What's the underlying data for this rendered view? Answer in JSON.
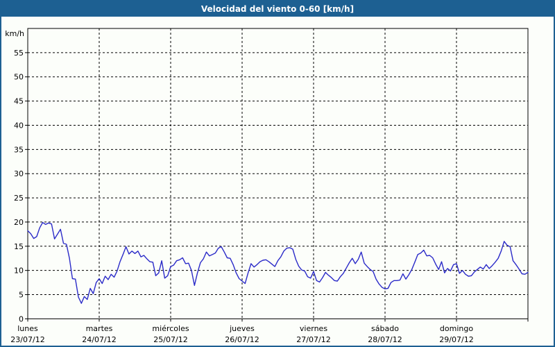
{
  "window": {
    "title": "Velocidad del viento 0-60 [km/h]"
  },
  "colors": {
    "titlebar_bg": "#1d6092",
    "titlebar_text": "#ffffff",
    "frame": "#1d6092",
    "background": "#fcfefa",
    "line": "#2a2ac8",
    "grid": "#000000",
    "axis": "#000000",
    "text": "#000000"
  },
  "chart_data": {
    "type": "line",
    "title": "Velocidad del viento 0-60 [km/h]",
    "ylabel": "km/h",
    "ylim": [
      0,
      60
    ],
    "y_ticks": [
      0,
      5,
      10,
      15,
      20,
      25,
      30,
      35,
      40,
      45,
      50,
      55
    ],
    "grid": "dashed",
    "legend": "none",
    "x_axis": {
      "unit": "days",
      "tick_labels": [
        {
          "name": "lunes",
          "date": "23/07/12"
        },
        {
          "name": "martes",
          "date": "24/07/12"
        },
        {
          "name": "miércoles",
          "date": "25/07/12"
        },
        {
          "name": "jueves",
          "date": "26/07/12"
        },
        {
          "name": "viernes",
          "date": "27/07/12"
        },
        {
          "name": "sábado",
          "date": "28/07/12"
        },
        {
          "name": "domingo",
          "date": "29/07/12"
        }
      ]
    },
    "series": [
      {
        "name": "Velocidad del viento",
        "color": "#2a2ac8",
        "sampling": "hourly",
        "hours_span": 168,
        "values": [
          18.2,
          17.6,
          16.6,
          17.0,
          18.8,
          19.9,
          19.5,
          19.8,
          19.6,
          16.5,
          17.5,
          18.5,
          15.6,
          15.4,
          12.5,
          8.3,
          8.2,
          4.5,
          3.2,
          4.6,
          4.0,
          6.3,
          5.2,
          7.5,
          8.3,
          7.3,
          8.8,
          8.1,
          9.2,
          8.6,
          9.9,
          11.8,
          13.3,
          14.9,
          13.4,
          14.0,
          13.5,
          14.0,
          12.8,
          13.1,
          12.4,
          11.8,
          11.7,
          8.9,
          9.5,
          12.0,
          8.4,
          8.9,
          10.8,
          11.1,
          12.0,
          12.2,
          12.6,
          11.4,
          11.5,
          10.0,
          6.9,
          9.5,
          11.6,
          12.4,
          13.8,
          13.0,
          13.3,
          13.6,
          14.6,
          14.9,
          13.8,
          12.6,
          12.5,
          11.2,
          9.5,
          8.3,
          7.8,
          7.3,
          9.5,
          11.4,
          10.7,
          11.2,
          11.8,
          12.1,
          12.2,
          11.8,
          11.3,
          10.8,
          12.0,
          12.8,
          14.0,
          14.6,
          14.7,
          14.4,
          12.3,
          10.9,
          10.1,
          9.9,
          8.7,
          8.4,
          9.8,
          7.9,
          7.6,
          8.5,
          9.6,
          9.0,
          8.5,
          7.9,
          7.8,
          8.7,
          9.4,
          10.5,
          11.6,
          12.5,
          11.4,
          12.3,
          13.8,
          11.5,
          10.8,
          10.2,
          9.8,
          8.2,
          7.2,
          6.5,
          6.2,
          6.3,
          7.5,
          7.9,
          7.9,
          8.0,
          9.3,
          8.2,
          9.1,
          10.2,
          11.7,
          13.3,
          13.6,
          14.2,
          13.0,
          13.1,
          12.6,
          11.3,
          10.2,
          11.8,
          9.5,
          10.4,
          9.9,
          11.2,
          11.4,
          9.4,
          10.0,
          9.2,
          8.8,
          8.9,
          9.7,
          10.2,
          10.7,
          10.3,
          11.2,
          10.4,
          11.0,
          11.7,
          12.5,
          14.0,
          16.0,
          15.2,
          14.9,
          12.0,
          11.2,
          10.3,
          9.3,
          9.2,
          9.6
        ]
      }
    ]
  }
}
